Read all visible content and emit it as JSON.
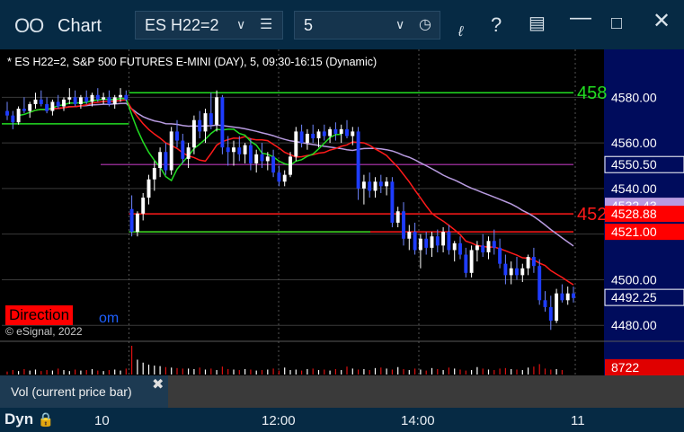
{
  "window": {
    "app_title": "Chart",
    "symbol_value": "ES H22=2",
    "interval_value": "5"
  },
  "chart_header": "* ES H22=2, S&P 500 FUTURES E-MINI (DAY), 5, 09:30-16:15 (Dynamic)",
  "copyright": "© eSignal, 2022",
  "direction_label": "Direction",
  "direction_tail": "om",
  "volume_panel": {
    "label": "Vol (current price bar)",
    "last_volume": "8722"
  },
  "bottom": {
    "dyn_label": "Dyn",
    "time_labels": [
      "10",
      "12:00",
      "14:00",
      "11"
    ]
  },
  "colors": {
    "background": "#000000",
    "titlebar": "#062a44",
    "up_candle": "#ffffff",
    "down_candle": "#1e3cff",
    "ma_red": "#ff1a1a",
    "ma_purple": "#b89be0",
    "ma_green": "#22dd22",
    "level_green": "#22dd22",
    "level_red": "#ff1a1a",
    "level_purple": "#8a2a8a"
  },
  "chart_data": {
    "type": "candlestick",
    "price_axis": {
      "ticks": [
        4480,
        4500,
        4520,
        4540,
        4560,
        4580
      ],
      "tick_labels": [
        "4480.00",
        "4500.00",
        "",
        "4540.00",
        "4560.00",
        "4580.00"
      ],
      "ylim": [
        4473,
        4601
      ]
    },
    "price_tags": [
      {
        "label": "4550.50",
        "value": 4550.5,
        "bg": "#000c5c",
        "fg": "#ffffff",
        "border": "#ffffff"
      },
      {
        "label": "4532.43",
        "value": 4532.43,
        "bg": "#b89be0",
        "fg": "#ffffff"
      },
      {
        "label": "4528.88",
        "value": 4528.88,
        "bg": "#ff0000",
        "fg": "#ffffff"
      },
      {
        "label": "4521.00",
        "value": 4521.0,
        "bg": "#ff0000",
        "fg": "#ffffff"
      },
      {
        "label": "4492.25",
        "value": 4492.25,
        "bg": "#000c5c",
        "fg": "#ffffff",
        "border": "#ffffff"
      }
    ],
    "level_lines": [
      {
        "value": 4582,
        "color": "#22dd22",
        "label": "458"
      },
      {
        "value": 4550.5,
        "color": "#8a2a8a",
        "label": ""
      },
      {
        "value": 4528.88,
        "color": "#ff1a1a",
        "label": "452"
      },
      {
        "value": 4521,
        "color": "#ff1a1a",
        "label": ""
      },
      {
        "value": 4521,
        "color": "#22dd22",
        "label": ""
      }
    ],
    "session_break_index": 22,
    "candles": [
      [
        4574,
        4578,
        4570,
        4572
      ],
      [
        4572,
        4574,
        4566,
        4569
      ],
      [
        4569,
        4576,
        4568,
        4575
      ],
      [
        4575,
        4580,
        4573,
        4574
      ],
      [
        4574,
        4578,
        4571,
        4577
      ],
      [
        4577,
        4582,
        4575,
        4579
      ],
      [
        4579,
        4583,
        4576,
        4577
      ],
      [
        4577,
        4580,
        4573,
        4574
      ],
      [
        4574,
        4579,
        4572,
        4578
      ],
      [
        4578,
        4581,
        4575,
        4576
      ],
      [
        4576,
        4580,
        4574,
        4579
      ],
      [
        4579,
        4584,
        4577,
        4580
      ],
      [
        4580,
        4583,
        4576,
        4577
      ],
      [
        4577,
        4581,
        4575,
        4580
      ],
      [
        4580,
        4583,
        4577,
        4578
      ],
      [
        4578,
        4582,
        4576,
        4581
      ],
      [
        4581,
        4584,
        4578,
        4579
      ],
      [
        4579,
        4582,
        4577,
        4580
      ],
      [
        4580,
        4583,
        4576,
        4577
      ],
      [
        4577,
        4581,
        4575,
        4580
      ],
      [
        4580,
        4584,
        4578,
        4581
      ],
      [
        4581,
        4583,
        4578,
        4579
      ],
      [
        4531,
        4537,
        4519,
        4521
      ],
      [
        4521,
        4530,
        4519,
        4529
      ],
      [
        4529,
        4538,
        4526,
        4536
      ],
      [
        4536,
        4546,
        4533,
        4544
      ],
      [
        4544,
        4552,
        4539,
        4549
      ],
      [
        4549,
        4558,
        4545,
        4556
      ],
      [
        4556,
        4560,
        4546,
        4548
      ],
      [
        4548,
        4567,
        4546,
        4565
      ],
      [
        4565,
        4570,
        4558,
        4561
      ],
      [
        4561,
        4564,
        4551,
        4553
      ],
      [
        4553,
        4560,
        4549,
        4558
      ],
      [
        4558,
        4572,
        4555,
        4570
      ],
      [
        4570,
        4574,
        4562,
        4565
      ],
      [
        4565,
        4575,
        4560,
        4573
      ],
      [
        4573,
        4582,
        4566,
        4568
      ],
      [
        4568,
        4583,
        4565,
        4580
      ],
      [
        4580,
        4581,
        4555,
        4558
      ],
      [
        4558,
        4563,
        4550,
        4556
      ],
      [
        4556,
        4561,
        4550,
        4558
      ],
      [
        4558,
        4563,
        4552,
        4555
      ],
      [
        4555,
        4560,
        4551,
        4559
      ],
      [
        4559,
        4562,
        4548,
        4551
      ],
      [
        4551,
        4557,
        4547,
        4555
      ],
      [
        4555,
        4560,
        4549,
        4552
      ],
      [
        4552,
        4556,
        4548,
        4554
      ],
      [
        4554,
        4557,
        4545,
        4547
      ],
      [
        4547,
        4550,
        4541,
        4543
      ],
      [
        4543,
        4548,
        4541,
        4546
      ],
      [
        4546,
        4556,
        4545,
        4554
      ],
      [
        4554,
        4567,
        4552,
        4565
      ],
      [
        4565,
        4568,
        4558,
        4560
      ],
      [
        4560,
        4566,
        4557,
        4564
      ],
      [
        4564,
        4568,
        4560,
        4562
      ],
      [
        4562,
        4566,
        4558,
        4565
      ],
      [
        4565,
        4568,
        4561,
        4563
      ],
      [
        4563,
        4567,
        4560,
        4566
      ],
      [
        4566,
        4569,
        4561,
        4564
      ],
      [
        4564,
        4568,
        4560,
        4566
      ],
      [
        4566,
        4570,
        4562,
        4563
      ],
      [
        4563,
        4567,
        4559,
        4565
      ],
      [
        4565,
        4567,
        4535,
        4540
      ],
      [
        4540,
        4546,
        4533,
        4543
      ],
      [
        4543,
        4547,
        4536,
        4539
      ],
      [
        4539,
        4545,
        4536,
        4543
      ],
      [
        4543,
        4546,
        4538,
        4541
      ],
      [
        4541,
        4545,
        4537,
        4543
      ],
      [
        4543,
        4545,
        4523,
        4525
      ],
      [
        4525,
        4532,
        4523,
        4530
      ],
      [
        4530,
        4534,
        4515,
        4518
      ],
      [
        4518,
        4524,
        4513,
        4521
      ],
      [
        4521,
        4525,
        4511,
        4513
      ],
      [
        4513,
        4520,
        4505,
        4518
      ],
      [
        4518,
        4521,
        4511,
        4514
      ],
      [
        4514,
        4521,
        4510,
        4519
      ],
      [
        4519,
        4522,
        4512,
        4515
      ],
      [
        4515,
        4523,
        4512,
        4521
      ],
      [
        4521,
        4524,
        4511,
        4513
      ],
      [
        4513,
        4517,
        4508,
        4516
      ],
      [
        4516,
        4519,
        4509,
        4511
      ],
      [
        4511,
        4514,
        4501,
        4503
      ],
      [
        4503,
        4515,
        4501,
        4513
      ],
      [
        4513,
        4517,
        4508,
        4515
      ],
      [
        4515,
        4520,
        4510,
        4512
      ],
      [
        4512,
        4519,
        4509,
        4517
      ],
      [
        4517,
        4522,
        4511,
        4514
      ],
      [
        4514,
        4518,
        4505,
        4507
      ],
      [
        4507,
        4511,
        4498,
        4502
      ],
      [
        4502,
        4508,
        4498,
        4505
      ],
      [
        4505,
        4510,
        4500,
        4502
      ],
      [
        4502,
        4507,
        4499,
        4505
      ],
      [
        4505,
        4511,
        4502,
        4510
      ],
      [
        4510,
        4514,
        4503,
        4506
      ],
      [
        4506,
        4509,
        4489,
        4491
      ],
      [
        4491,
        4495,
        4486,
        4488
      ],
      [
        4488,
        4493,
        4478,
        4482
      ],
      [
        4482,
        4496,
        4481,
        4494
      ],
      [
        4494,
        4498,
        4490,
        4491
      ],
      [
        4491,
        4497,
        4489,
        4494
      ],
      [
        4494,
        4497,
        4490,
        4492
      ]
    ],
    "volumes": [
      6,
      9,
      7,
      11,
      8,
      10,
      7,
      9,
      8,
      12,
      9,
      7,
      10,
      8,
      9,
      11,
      8,
      7,
      9,
      10,
      8,
      12,
      58,
      30,
      24,
      20,
      18,
      17,
      15,
      14,
      13,
      12,
      12,
      11,
      14,
      10,
      12,
      9,
      16,
      11,
      10,
      9,
      11,
      10,
      8,
      9,
      10,
      12,
      8,
      14,
      9,
      10,
      8,
      11,
      12,
      9,
      10,
      8,
      11,
      9,
      16,
      12,
      10,
      11,
      9,
      13,
      14,
      12,
      10,
      15,
      11,
      9,
      12,
      10,
      8,
      13,
      11,
      9,
      14,
      12,
      10,
      8,
      9,
      15,
      12,
      10,
      9,
      12,
      13,
      11,
      10,
      9,
      14,
      16,
      21,
      12,
      10,
      11,
      9
    ]
  }
}
